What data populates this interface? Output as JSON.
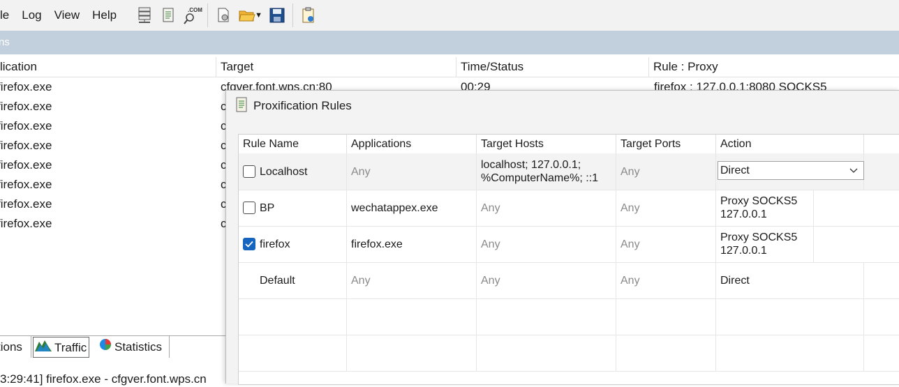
{
  "menu": [
    "le",
    "Log",
    "View",
    "Help"
  ],
  "toolbar": {
    "icons": [
      "server-list-icon",
      "log-icon",
      "dns-com-icon",
      "new-profile-icon",
      "open-profile-icon",
      "save-profile-icon",
      "clipboard-icon"
    ]
  },
  "section_title": "ns",
  "connections": {
    "headers": [
      "lication",
      "Target",
      "Time/Status",
      "Rule : Proxy"
    ],
    "rows": [
      {
        "app": "firefox.exe",
        "target": "cfgver.font.wps.cn:80",
        "time": "00:29",
        "rule": "firefox : 127.0.0.1:8080 SOCKS5"
      },
      {
        "app": "firefox.exe",
        "target": "c"
      },
      {
        "app": "firefox.exe",
        "target": "c"
      },
      {
        "app": "firefox.exe",
        "target": "c"
      },
      {
        "app": "firefox.exe",
        "target": "c"
      },
      {
        "app": "firefox.exe",
        "target": "c"
      },
      {
        "app": "firefox.exe",
        "target": "c"
      },
      {
        "app": "firefox.exe",
        "target": "c"
      }
    ]
  },
  "bottom_tabs": [
    "tions",
    "Traffic",
    "Statistics"
  ],
  "log_line": "3:29:41] firefox.exe - cfgver.font.wps.cn",
  "dialog": {
    "title": "Proxification Rules",
    "headers": [
      "Rule Name",
      "Applications",
      "Target Hosts",
      "Target Ports",
      "Action"
    ],
    "rules": [
      {
        "name": "Localhost",
        "checked": false,
        "apps": "Any",
        "hosts": "localhost; 127.0.0.1; %ComputerName%; ::1",
        "ports": "Any",
        "action": "Direct"
      },
      {
        "name": "BP",
        "checked": false,
        "apps": "wechatappex.exe",
        "hosts": "Any",
        "ports": "Any",
        "action": "Proxy SOCKS5 127.0.0.1"
      },
      {
        "name": "firefox",
        "checked": true,
        "apps": "firefox.exe",
        "hosts": "Any",
        "ports": "Any",
        "action": "Proxy SOCKS5 127.0.0.1"
      },
      {
        "name": "Default",
        "checked": null,
        "apps": "Any",
        "hosts": "Any",
        "ports": "Any",
        "action": "Direct"
      }
    ]
  },
  "colors": {
    "section_bar": "#c2cfdc",
    "checkbox_accent": "#1565c0"
  }
}
